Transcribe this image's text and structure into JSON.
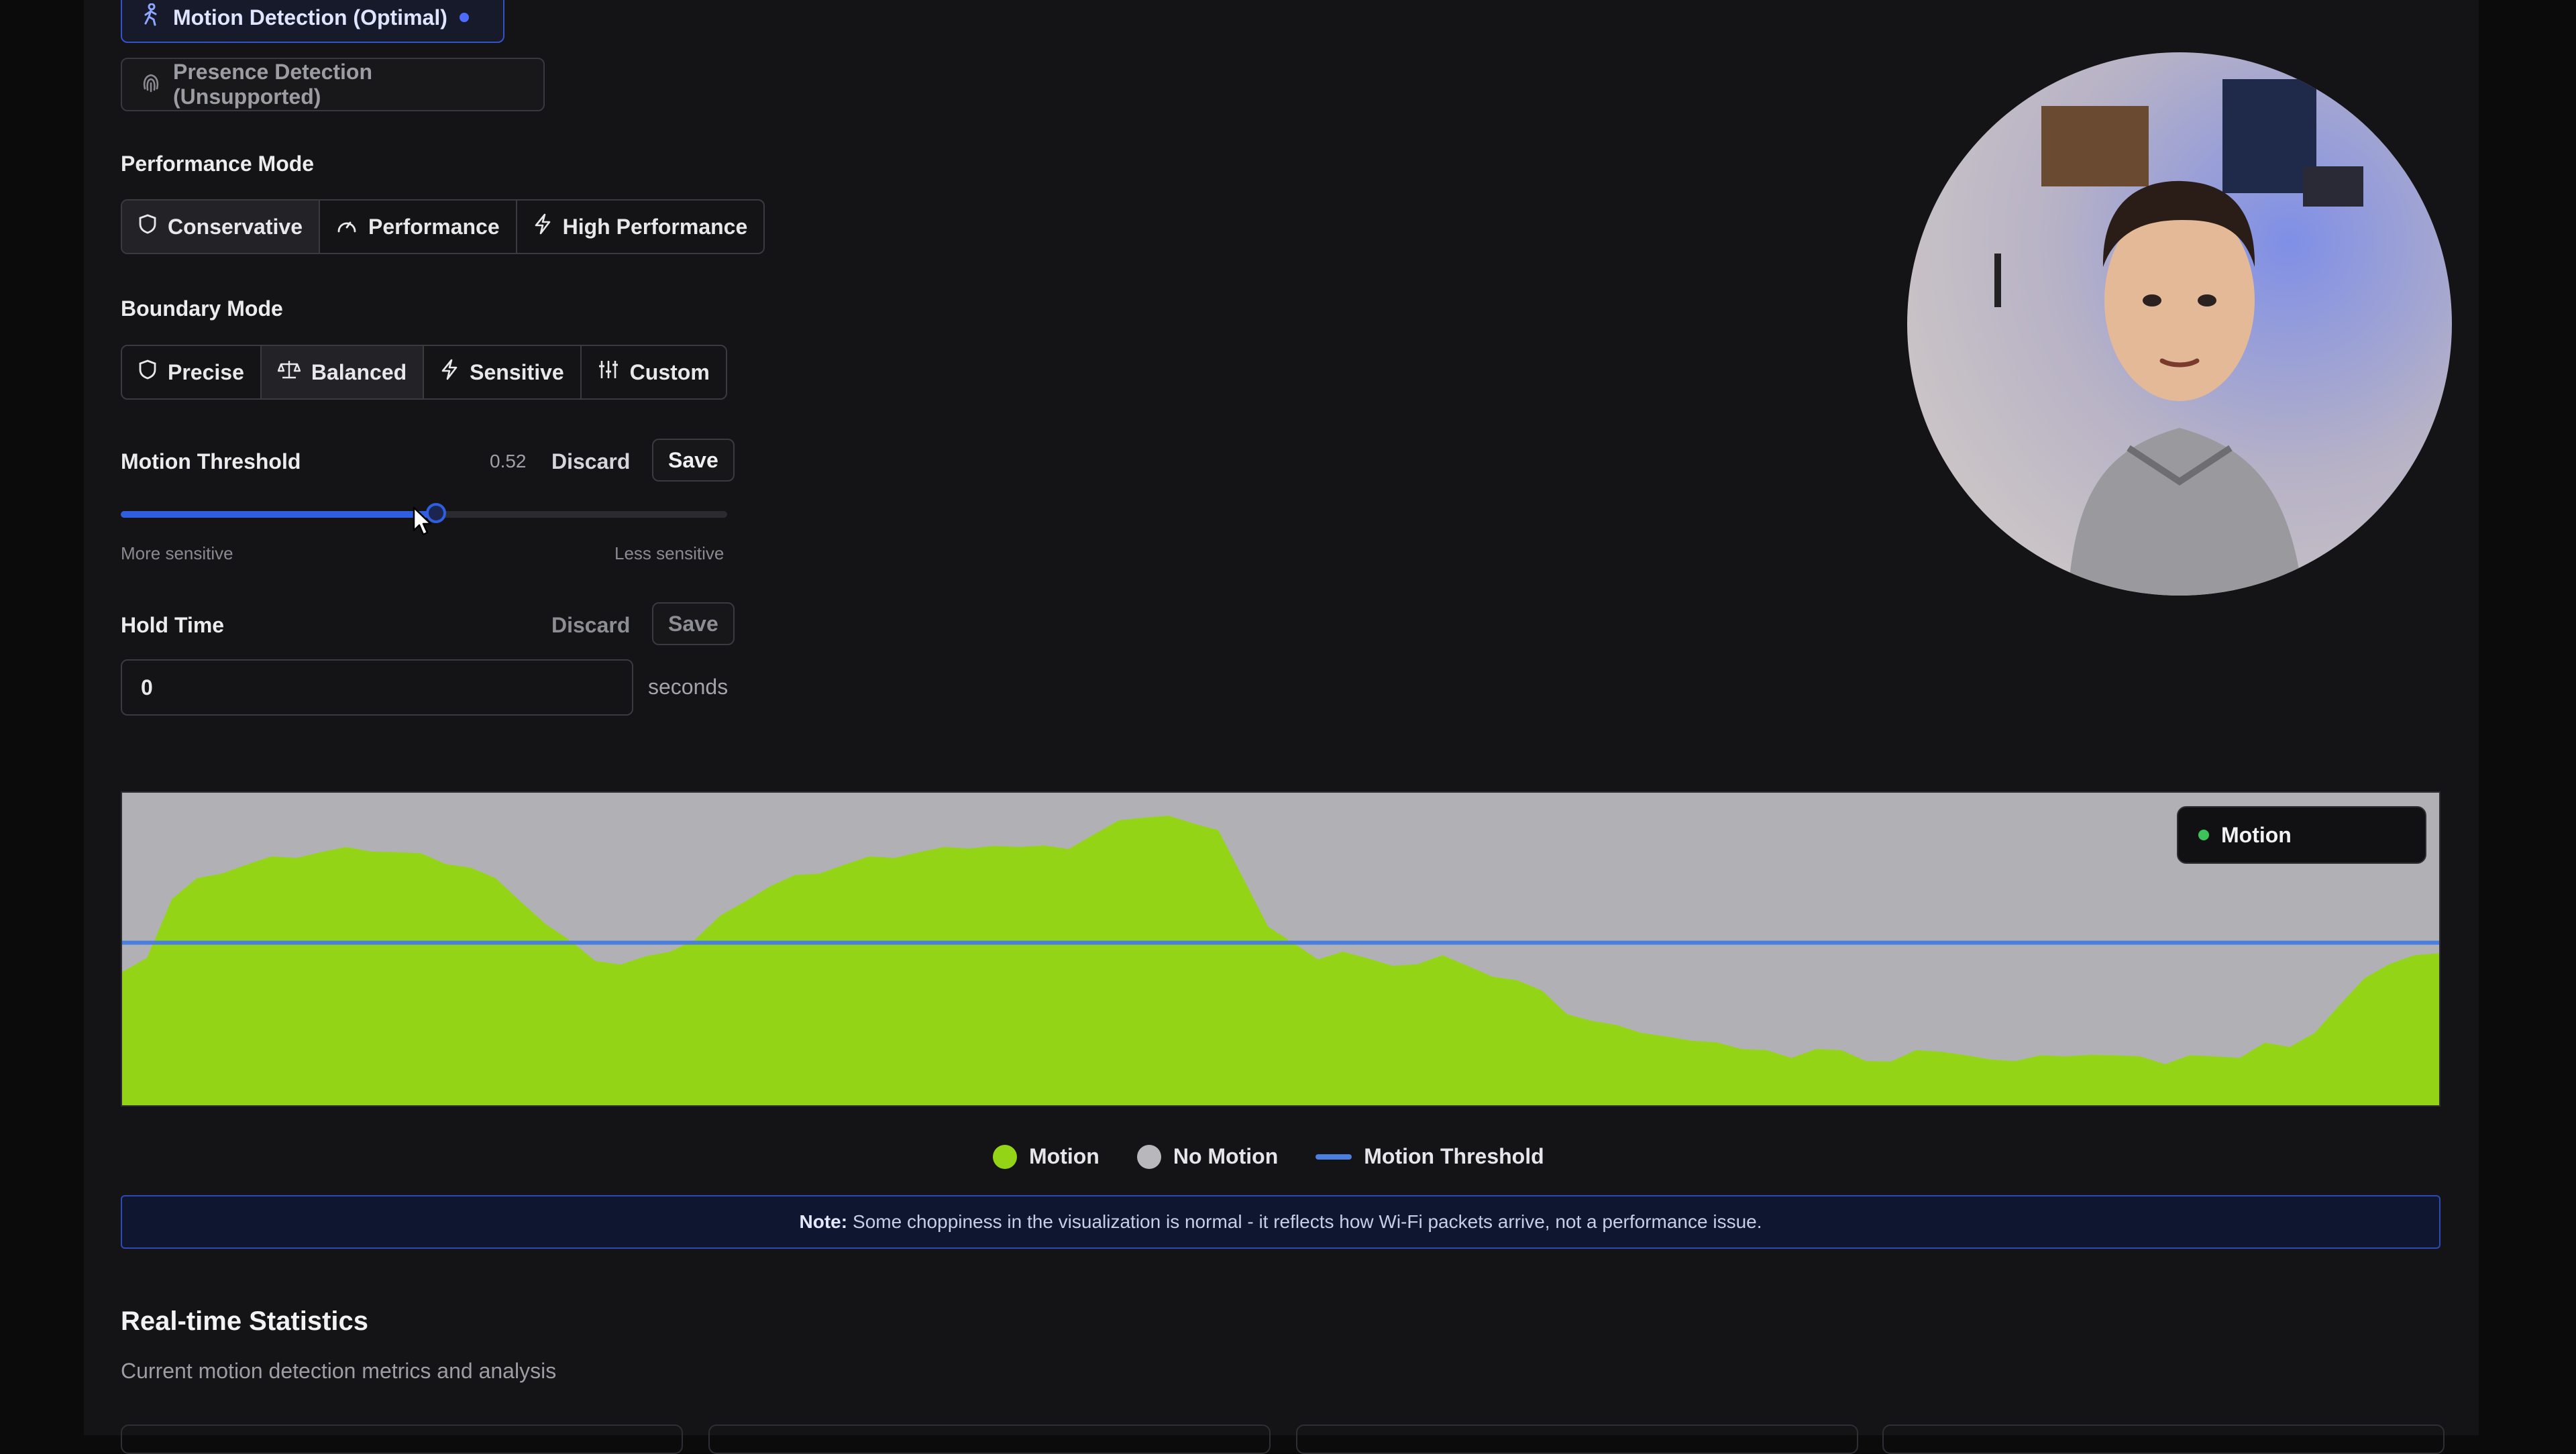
{
  "detection_modes": {
    "motion": {
      "label": "Motion Detection (Optimal)",
      "icon": "person-walking-icon"
    },
    "presence": {
      "label": "Presence Detection (Unsupported)",
      "icon": "fingerprint-icon"
    }
  },
  "performance_mode": {
    "title": "Performance Mode",
    "options": [
      {
        "label": "Conservative",
        "icon": "shield-icon",
        "selected": true
      },
      {
        "label": "Performance",
        "icon": "gauge-icon",
        "selected": false
      },
      {
        "label": "High Performance",
        "icon": "lightning-icon",
        "selected": false
      }
    ]
  },
  "boundary_mode": {
    "title": "Boundary Mode",
    "options": [
      {
        "label": "Precise",
        "icon": "shield-icon",
        "selected": false
      },
      {
        "label": "Balanced",
        "icon": "scale-icon",
        "selected": true
      },
      {
        "label": "Sensitive",
        "icon": "lightning-icon",
        "selected": false
      },
      {
        "label": "Custom",
        "icon": "sliders-icon",
        "selected": false
      }
    ]
  },
  "motion_threshold": {
    "label": "Motion Threshold",
    "value": "0.52",
    "slider_fraction": 0.52,
    "discard_label": "Discard",
    "save_label": "Save",
    "min_label": "More sensitive",
    "max_label": "Less sensitive"
  },
  "hold_time": {
    "label": "Hold Time",
    "discard_label": "Discard",
    "save_label": "Save",
    "value": "0",
    "unit": "seconds"
  },
  "chart_data": {
    "type": "area",
    "threshold": 0.52,
    "ylim": [
      0,
      1
    ],
    "colors": {
      "motion": "#93d516",
      "no_motion": "#b1b1b5",
      "threshold": "#4a7fe0"
    },
    "legend_box": {
      "label": "Motion"
    },
    "legend": [
      {
        "label": "Motion",
        "color": "#93d516",
        "kind": "dot"
      },
      {
        "label": "No Motion",
        "color": "#b8b8bc",
        "kind": "dot"
      },
      {
        "label": "Motion Threshold",
        "color": "#4a7fe0",
        "kind": "line"
      }
    ],
    "values": [
      0.42,
      0.48,
      0.66,
      0.72,
      0.75,
      0.77,
      0.79,
      0.8,
      0.81,
      0.82,
      0.82,
      0.81,
      0.8,
      0.78,
      0.76,
      0.72,
      0.66,
      0.58,
      0.52,
      0.47,
      0.45,
      0.47,
      0.5,
      0.53,
      0.6,
      0.66,
      0.7,
      0.73,
      0.75,
      0.77,
      0.79,
      0.8,
      0.81,
      0.82,
      0.83,
      0.83,
      0.82,
      0.84,
      0.82,
      0.86,
      0.92,
      0.92,
      0.92,
      0.91,
      0.88,
      0.72,
      0.58,
      0.52,
      0.46,
      0.5,
      0.47,
      0.44,
      0.46,
      0.48,
      0.44,
      0.42,
      0.4,
      0.36,
      0.3,
      0.27,
      0.25,
      0.24,
      0.22,
      0.2,
      0.21,
      0.18,
      0.17,
      0.16,
      0.18,
      0.17,
      0.15,
      0.14,
      0.17,
      0.18,
      0.16,
      0.14,
      0.15,
      0.16,
      0.15,
      0.17,
      0.16,
      0.15,
      0.14,
      0.16,
      0.15,
      0.16,
      0.2,
      0.18,
      0.24,
      0.32,
      0.4,
      0.46,
      0.48,
      0.48
    ]
  },
  "note": {
    "prefix": "Note:",
    "text": "Some choppiness in the visualization is normal - it reflects how Wi-Fi packets arrive, not a performance issue."
  },
  "stats": {
    "title": "Real-time Statistics",
    "subtitle": "Current motion detection metrics and analysis"
  }
}
